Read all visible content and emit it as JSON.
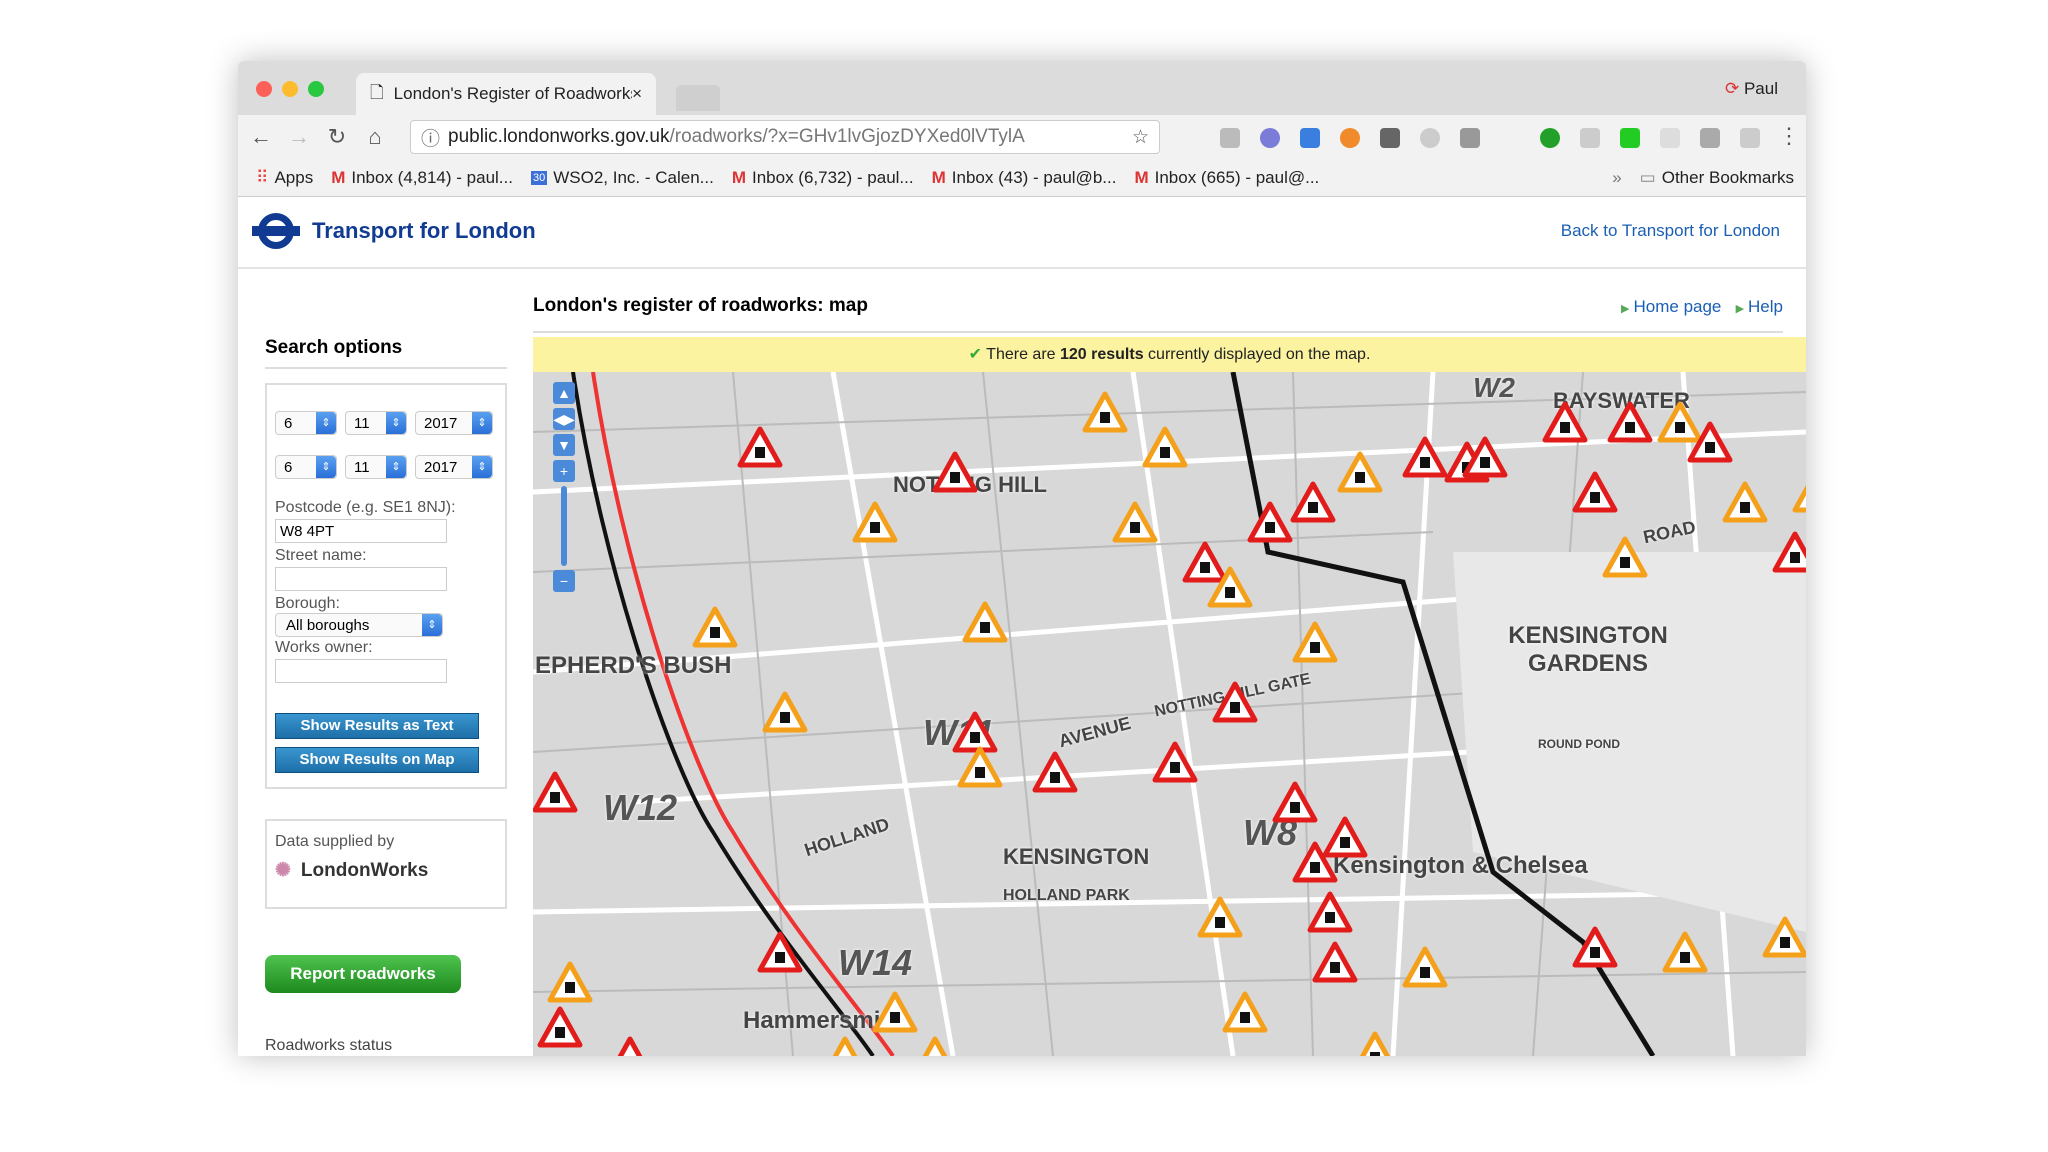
{
  "browser": {
    "tab_title": "London's Register of Roadworks",
    "user": "Paul",
    "url_host": "public.londonworks.gov.uk",
    "url_path": "/roadworks/?x=GHv1lvGjozDYXed0lVTylA",
    "bookmarks": [
      "Apps",
      "Inbox (4,814) - paul...",
      "WSO2, Inc. - Calen...",
      "Inbox (6,732) - paul...",
      "Inbox (43) - paul@b...",
      "Inbox (665) - paul@..."
    ],
    "other_bookmarks": "Other Bookmarks",
    "more": "»"
  },
  "header": {
    "brand": "Transport for London",
    "back_link": "Back to Transport for London"
  },
  "sidebar": {
    "title": "Search options",
    "from": {
      "day": "6",
      "month": "11",
      "year": "2017"
    },
    "to": {
      "day": "6",
      "month": "11",
      "year": "2017"
    },
    "postcode_label": "Postcode (e.g. SE1 8NJ):",
    "postcode_value": "W8 4PT",
    "street_label": "Street name:",
    "street_value": "",
    "borough_label": "Borough:",
    "borough_value": "All boroughs",
    "owner_label": "Works owner:",
    "owner_value": "",
    "btn_text": "Show Results as Text",
    "btn_map": "Show Results on Map",
    "supplied_by": "Data supplied by",
    "supplier": "LondonWorks",
    "report": "Report roadworks",
    "status_title": "Roadworks status"
  },
  "main": {
    "title": "London's register of roadworks: map",
    "home_link": "Home page",
    "help_link": "Help",
    "notice_pre": "There are ",
    "notice_count": "120 results",
    "notice_post": " currently displayed on the map."
  },
  "map": {
    "labels": [
      "NOTTING HILL",
      "KENSINGTON GARDENS",
      "W11",
      "W12",
      "W14",
      "W8",
      "KENSINGTON",
      "HOLLAND PARK",
      "Kensington & Chelsea",
      "BAYSWATER",
      "Hammersmith",
      "EPHERD'S BUSH",
      "HOLLAND",
      "AVENUE",
      "NOTTING HILL GATE",
      "W2",
      "ROAD",
      "ROUND POND"
    ]
  },
  "colors": {
    "accent": "#113b92",
    "link": "#1a5fb4",
    "notice": "#fbf3a0",
    "marker": "#e21b1b"
  }
}
